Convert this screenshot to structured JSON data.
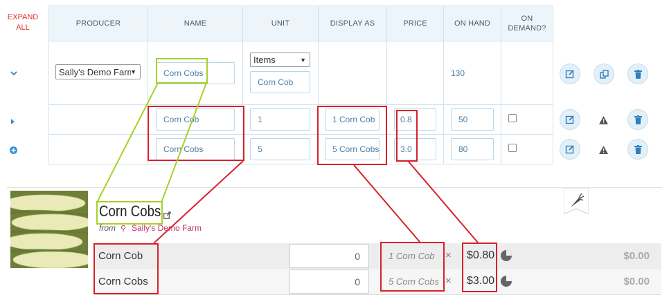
{
  "header": {
    "expand_all": "EXPAND ALL",
    "producer": "PRODUCER",
    "name": "NAME",
    "unit": "UNIT",
    "display_as": "DISPLAY AS",
    "price": "PRICE",
    "on_hand": "ON HAND",
    "on_demand": "ON DEMAND?"
  },
  "product": {
    "producer": "Sally's Demo Farm",
    "name": "Corn Cobs",
    "unit_type": "Items",
    "unit_name": "Corn Cob",
    "on_hand": "130"
  },
  "variants": [
    {
      "name": "Corn Cob",
      "unit": "1",
      "display_as": "1 Corn Cob",
      "price": "0.8",
      "on_hand": "50"
    },
    {
      "name": "Corn Cobs",
      "unit": "5",
      "display_as": "5 Corn Cobs",
      "price": "3.0",
      "on_hand": "80"
    }
  ],
  "shop": {
    "title": "Corn Cobs",
    "from_label": "from",
    "producer": "Sally's Demo Farm",
    "rows": [
      {
        "name": "Corn Cob",
        "qty": "0",
        "unit": "1 Corn Cob",
        "times": "×",
        "price": "$0.80",
        "total": "$0.00"
      },
      {
        "name": "Corn Cobs",
        "qty": "0",
        "unit": "5 Corn Cobs",
        "times": "×",
        "price": "$3.00",
        "total": "$0.00"
      }
    ]
  },
  "colors": {
    "accent": "#3a8fd1",
    "annotation_red": "#d9202b",
    "annotation_lime": "#a6d12a",
    "producer_link": "#c0306a"
  }
}
